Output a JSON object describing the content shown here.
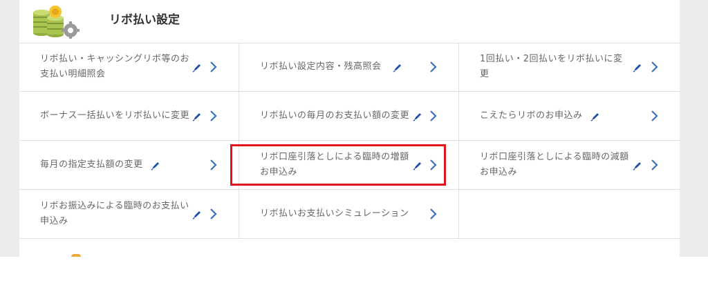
{
  "header": {
    "title": "リボ払い設定",
    "icon": "coins-gear-icon"
  },
  "items": [
    {
      "label": "リボ払い・キャッシングリボ等のお支払い明細照会",
      "icon": "pen-icon"
    },
    {
      "label": "リボ払い設定内容・残高照会",
      "icon": "pen-icon"
    },
    {
      "label": "1回払い・2回払いをリボ払いに変更",
      "icon": "pen-icon"
    },
    {
      "label": "ボーナス一括払いをリボ払いに変更",
      "icon": "pen-icon"
    },
    {
      "label": "リボ払いの毎月のお支払い額の変更",
      "icon": "pen-icon"
    },
    {
      "label": "こえたらリボのお申込み",
      "icon": "pen-icon"
    },
    {
      "label": "毎月の指定支払額の変更",
      "icon": "pen-icon"
    },
    {
      "label": "リボ口座引落としによる臨時の増額お申込み",
      "icon": "pen-icon"
    },
    {
      "label": "リボ口座引落としによる臨時の減額お申込み",
      "icon": "pen-icon"
    },
    {
      "label": "リボお振込みによる臨時のお支払い申込み",
      "icon": "pen-icon"
    },
    {
      "label": "リボ払いお支払いシミュレーション",
      "icon": "none"
    }
  ],
  "colors": {
    "chevron": "#3b6fc0",
    "pen": "#1e4fa8",
    "highlight": "#e0141e"
  }
}
